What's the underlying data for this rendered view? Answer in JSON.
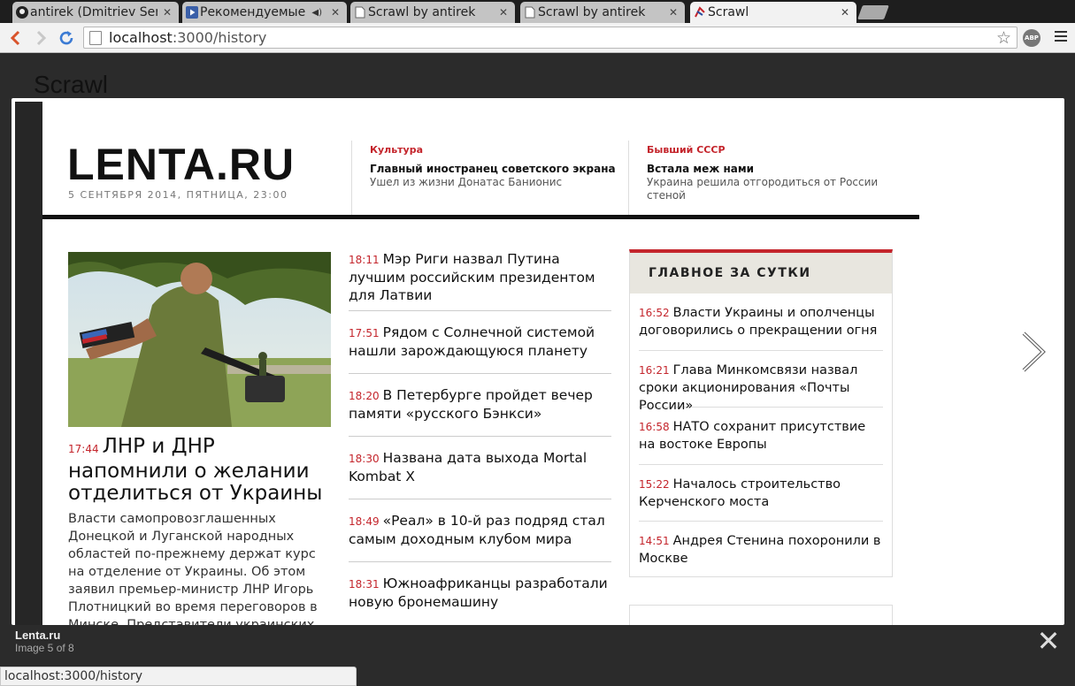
{
  "browser": {
    "tabs": [
      {
        "title": "antirek (Dmitriev Serg",
        "icon": "github-icon",
        "active": false
      },
      {
        "title": "Рекомендуемые а",
        "icon": "video-icon",
        "active": false,
        "audio": true
      },
      {
        "title": "Scrawl by antirek",
        "icon": "page-icon",
        "active": false
      },
      {
        "title": "Scrawl by antirek",
        "icon": "page-icon",
        "active": false
      },
      {
        "title": "Scrawl",
        "icon": "scrawl-icon",
        "active": true
      }
    ],
    "address": {
      "host": "localhost",
      "rest": ":3000/history"
    },
    "abp_label": "ABP",
    "status_url": "localhost:3000/history"
  },
  "page": {
    "heading": "Scrawl"
  },
  "lightbox": {
    "caption_title": "Lenta.ru",
    "caption_sub": "Image 5 of 8"
  },
  "lenta": {
    "logo": "LENTA.RU",
    "date": "5 СЕНТЯБРЯ 2014, ПЯТНИЦА, 23:00",
    "header_blocks": [
      {
        "category": "Культура",
        "title": "Главный иностранец советского экрана",
        "subtitle": "Ушел из жизни Донатас Банионис"
      },
      {
        "category": "Бывший СССР",
        "title": "Встала меж нами",
        "subtitle": "Украина решила отгородиться от России стеной"
      }
    ],
    "lead": {
      "time": "17:44",
      "title": "ЛНР и ДНР напомнили о желании отделиться от Украины",
      "text": "Власти самопровозглашенных Донецкой и Луганской народных областей по-прежнему держат курс на отделение от Украины. Об этом заявил премьер-министр ЛНР Игорь Плотницкий во время переговоров в Минске. Представители украинских властей"
    },
    "news": [
      {
        "time": "18:11",
        "title": "Мэр Риги назвал Путина лучшим российским президентом для Латвии"
      },
      {
        "time": "17:51",
        "title": "Рядом с Солнечной системой нашли зарождающуюся планету"
      },
      {
        "time": "18:20",
        "title": "В Петербурге пройдет вечер памяти «русского Бэнкси»"
      },
      {
        "time": "18:30",
        "title": "Названа дата выхода Mortal Kombat X"
      },
      {
        "time": "18:49",
        "title": "«Реал» в 10-й раз подряд стал самым доходным клубом мира"
      },
      {
        "time": "18:31",
        "title": "Южноафриканцы разработали новую бронемашину"
      }
    ],
    "main_box": {
      "heading": "ГЛАВНОЕ ЗА СУТКИ",
      "items": [
        {
          "time": "16:52",
          "title": "Власти Украины и ополченцы договорились о прекращении огня"
        },
        {
          "time": "16:21",
          "title": "Глава Минкомсвязи назвал сроки акционирования «Почты России»"
        },
        {
          "time": "16:58",
          "title": "НАТО сохранит присутствие на востоке Европы"
        },
        {
          "time": "15:22",
          "title": "Началось строительство Керченского моста"
        },
        {
          "time": "14:51",
          "title": "Андрея Стенина похоронили в Москве"
        }
      ]
    }
  }
}
